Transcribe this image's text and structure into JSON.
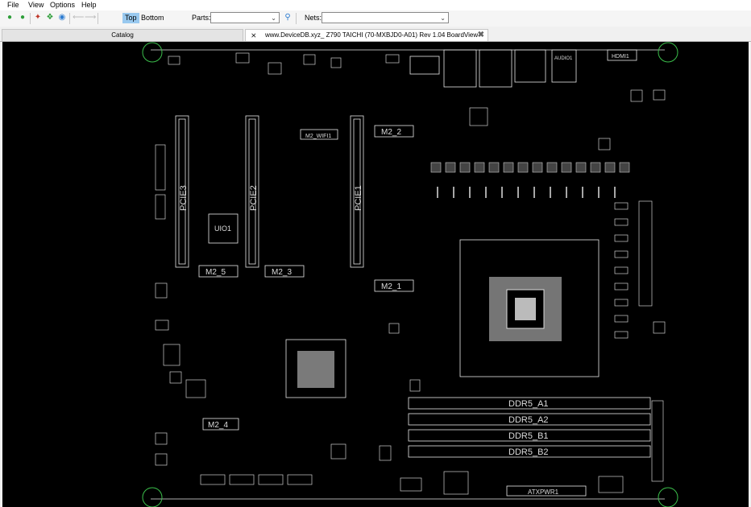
{
  "menu": [
    "File",
    "View",
    "Options",
    "Help"
  ],
  "toolbar": {
    "icons": [
      "zoom-in-icon",
      "zoom-out-icon",
      "zoom-area-icon",
      "fit-icon",
      "zoom-prev-icon",
      "back-arrow-icon",
      "forward-arrow-icon"
    ],
    "top_label": "Top",
    "bottom_label": "Bottom",
    "parts_label": "Parts:",
    "parts_value": "",
    "nets_label": "Nets:",
    "nets_value": ""
  },
  "tabs": {
    "catalog": "Catalog",
    "board": "www.DeviceDB.xyz_ Z790 TAICHI (70-MXBJD0-A01) Rev 1.04 BoardView"
  },
  "board": {
    "labels": {
      "pcie3": "PCIE3",
      "pcie2": "PCIE2",
      "pcie1": "PCIE1",
      "m2_wifi": "M2_WIFI1",
      "m2_2": "M2_2",
      "m2_5": "M2_5",
      "m2_3": "M2_3",
      "m2_1": "M2_1",
      "m2_4": "M2_4",
      "uio1": "UIO1",
      "hdmi": "HDMI1",
      "audio": "AUDIO1",
      "ddr5_a1": "DDR5_A1",
      "ddr5_a2": "DDR5_A2",
      "ddr5_b1": "DDR5_B1",
      "ddr5_b2": "DDR5_B2",
      "atxpwr": "ATXPWR1"
    }
  }
}
